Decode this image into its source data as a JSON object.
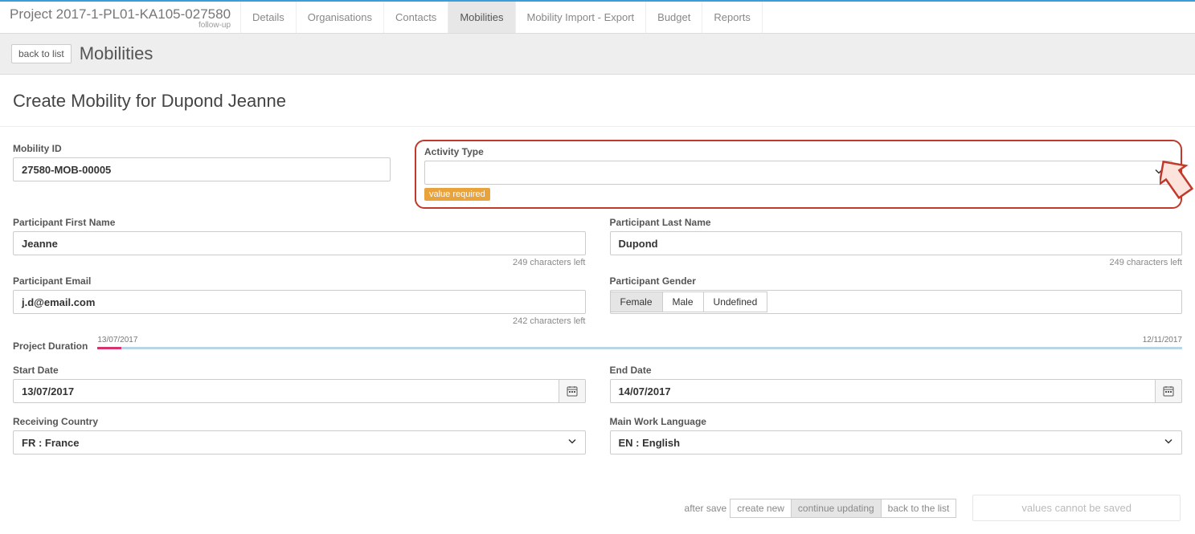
{
  "header": {
    "project_title": "Project 2017-1-PL01-KA105-027580",
    "project_sub": "follow-up",
    "tabs": [
      "Details",
      "Organisations",
      "Contacts",
      "Mobilities",
      "Mobility Import - Export",
      "Budget",
      "Reports"
    ],
    "active_tab_index": 3
  },
  "page": {
    "back_btn": "back to list",
    "title": "Mobilities",
    "create_title": "Create Mobility for Dupond Jeanne"
  },
  "mobility_id": {
    "label": "Mobility ID",
    "value": "27580-MOB-00005"
  },
  "activity_type": {
    "label": "Activity Type",
    "value": "",
    "validation": "value required"
  },
  "first_name": {
    "label": "Participant First Name",
    "value": "Jeanne",
    "chars_left": "249 characters left"
  },
  "last_name": {
    "label": "Participant Last Name",
    "value": "Dupond",
    "chars_left": "249 characters left"
  },
  "email": {
    "label": "Participant Email",
    "value": "j.d@email.com",
    "chars_left": "242 characters left"
  },
  "gender": {
    "label": "Participant Gender",
    "options": [
      "Female",
      "Male",
      "Undefined"
    ],
    "selected_index": 0
  },
  "duration": {
    "label": "Project Duration",
    "start": "13/07/2017",
    "end": "12/11/2017"
  },
  "start_date": {
    "label": "Start Date",
    "value": "13/07/2017"
  },
  "end_date": {
    "label": "End Date",
    "value": "14/07/2017"
  },
  "receiving_country": {
    "label": "Receiving Country",
    "value": "FR : France"
  },
  "work_language": {
    "label": "Main Work Language",
    "value": "EN : English"
  },
  "footer": {
    "after_save_label": "after save",
    "options": [
      "create new",
      "continue updating",
      "back to the list"
    ],
    "active_index": 1,
    "disabled_btn": "values cannot be saved"
  }
}
